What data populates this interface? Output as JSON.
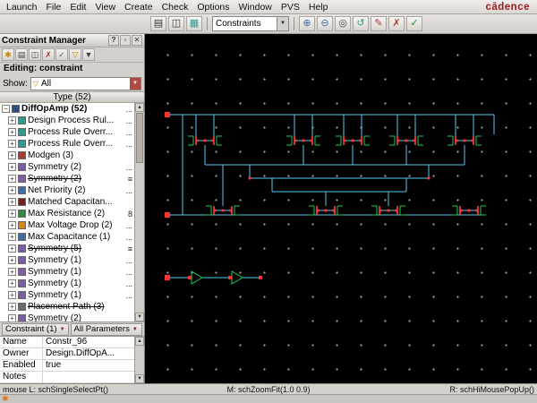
{
  "colors": {
    "cadence_red": "#9e1b1e",
    "wire": "#57c7f2",
    "device_green": "#1ecb5a",
    "device_red": "#ff3333",
    "canvas_bg": "#000000"
  },
  "icons": {
    "plus": "+",
    "minus": "−",
    "help": "?",
    "close": "✕",
    "float": "▫",
    "arrow_down": "▼",
    "arrow_up": "▲",
    "check": "✓",
    "cross": "✗",
    "funnel": "▽",
    "star": "✱",
    "pencil": "✎",
    "grid": "▦",
    "doc": "▤",
    "copy": "◫",
    "zoom_in": "⊕",
    "zoom_out": "⊖",
    "target": "◎",
    "undo": "↺",
    "launcher": "✱"
  },
  "menu": {
    "items": [
      "Launch",
      "File",
      "Edit",
      "View",
      "Create",
      "Check",
      "Options",
      "Window",
      "PVS",
      "Help"
    ],
    "logo": "cādence"
  },
  "toolbar": {
    "combo_value": "Constraints"
  },
  "panel": {
    "title": "Constraint Manager",
    "editing": "Editing: constraint",
    "show_label": "Show:",
    "show_value": "All",
    "tree_header": "Type (52)",
    "tree": [
      {
        "label": "DiffOpAmp (52)",
        "value": "...",
        "struck": false
      },
      {
        "label": "Design Process Rul...",
        "value": "...",
        "struck": false
      },
      {
        "label": "Process Rule Overr...",
        "value": "...",
        "struck": false
      },
      {
        "label": "Process Rule Overr...",
        "value": "...",
        "struck": false
      },
      {
        "label": "Modgen (3)",
        "value": "",
        "struck": false
      },
      {
        "label": "Symmetry (2)",
        "value": "...",
        "struck": false
      },
      {
        "label": "Symmetry (2)",
        "value": "≡",
        "struck": true
      },
      {
        "label": "Net Priority (2)",
        "value": "...",
        "struck": false
      },
      {
        "label": "Matched Capacitan...",
        "value": "",
        "struck": false
      },
      {
        "label": "Max Resistance (2)",
        "value": "8",
        "struck": false
      },
      {
        "label": "Max Voltage Drop (2)",
        "value": "...",
        "struck": false
      },
      {
        "label": "Max Capacitance (1)",
        "value": "...",
        "struck": false
      },
      {
        "label": "Symmetry (5)",
        "value": "≡",
        "struck": true
      },
      {
        "label": "Symmetry (1)",
        "value": "...",
        "struck": false
      },
      {
        "label": "Symmetry (1)",
        "value": "...",
        "struck": false
      },
      {
        "label": "Symmetry (1)",
        "value": "...",
        "struck": false
      },
      {
        "label": "Symmetry (1)",
        "value": "...",
        "struck": false
      },
      {
        "label": "Placement Path (3)",
        "value": "",
        "struck": true
      },
      {
        "label": "Symmetry (2)",
        "value": "",
        "struck": false
      }
    ],
    "selector": {
      "constraint": "Constraint (1)",
      "params": "All Parameters"
    },
    "properties": [
      {
        "name": "Name",
        "value": "Constr_96"
      },
      {
        "name": "Owner",
        "value": "Design.DiffOpA..."
      },
      {
        "name": "Enabled",
        "value": "true"
      },
      {
        "name": "Notes",
        "value": ""
      }
    ]
  },
  "status": {
    "left": "mouse L: schSingleSelectPt()",
    "middle": "M: schZoomFit(1.0 0.9)",
    "right": "R: schHiMousePopUp()"
  }
}
